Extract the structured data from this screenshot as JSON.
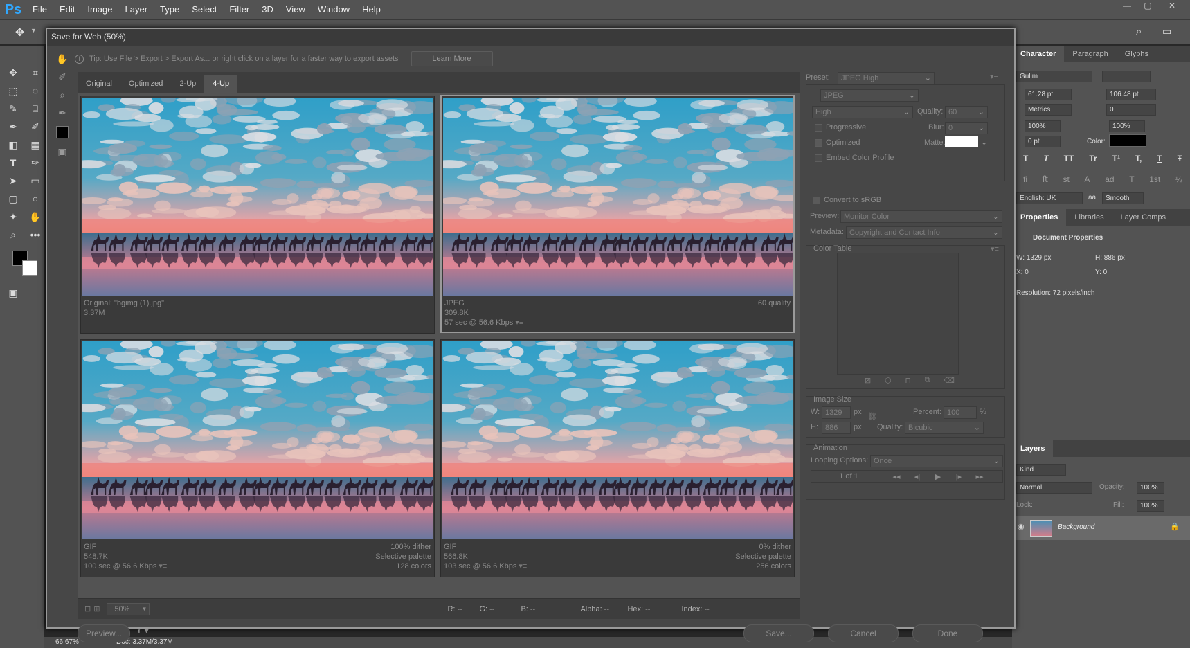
{
  "app": {
    "logo": "Ps"
  },
  "menu": [
    "File",
    "Edit",
    "Image",
    "Layer",
    "Type",
    "Select",
    "Filter",
    "3D",
    "View",
    "Window",
    "Help"
  ],
  "window_controls": [
    "—",
    "▢",
    "✕"
  ],
  "dialog": {
    "title": "Save for Web (50%)",
    "tip": "Tip: Use File > Export > Export As...   or right click on a layer for a faster way to export assets",
    "learn_more": "Learn More",
    "tabs": [
      "Original",
      "Optimized",
      "2-Up",
      "4-Up"
    ],
    "active_tab": "4-Up",
    "panes": [
      {
        "left1": "Original: \"bgimg (1).jpg\"",
        "left2": "3.37M",
        "left3": "",
        "right1": "",
        "right2": "",
        "right3": ""
      },
      {
        "left1": "JPEG",
        "left2": "309.8K",
        "left3": "57 sec @ 56.6 Kbps",
        "right1": "60 quality",
        "right2": "",
        "right3": ""
      },
      {
        "left1": "GIF",
        "left2": "548.7K",
        "left3": "100 sec @ 56.6 Kbps",
        "right1": "100% dither",
        "right2": "Selective palette",
        "right3": "128 colors"
      },
      {
        "left1": "GIF",
        "left2": "566.8K",
        "left3": "103 sec @ 56.6 Kbps",
        "right1": "0% dither",
        "right2": "Selective palette",
        "right3": "256 colors"
      }
    ],
    "zoom": "50%",
    "info": {
      "r": "R: --",
      "g": "G: --",
      "b": "B: --",
      "alpha": "Alpha: --",
      "hex": "Hex: --",
      "index": "Index: --"
    },
    "buttons": {
      "preview": "Preview...",
      "save": "Save...",
      "cancel": "Cancel",
      "done": "Done"
    },
    "settings": {
      "preset_label": "Preset:",
      "preset": "JPEG High",
      "format": "JPEG",
      "quality_level": "High",
      "quality_label": "Quality:",
      "quality": "60",
      "progressive": "Progressive",
      "blur_label": "Blur:",
      "blur": "0",
      "optimized": "Optimized",
      "matte_label": "Matte:",
      "embed": "Embed Color Profile",
      "convert": "Convert to sRGB",
      "preview_label": "Preview:",
      "preview": "Monitor Color",
      "metadata_label": "Metadata:",
      "metadata": "Copyright and Contact Info",
      "color_table": "Color Table",
      "image_size": "Image Size",
      "w_label": "W:",
      "w": "1329",
      "h_label": "H:",
      "h": "886",
      "px": "px",
      "percent_label": "Percent:",
      "percent": "100",
      "pct": "%",
      "resample_label": "Quality:",
      "resample": "Bicubic",
      "animation": "Animation",
      "looping_label": "Looping Options:",
      "looping": "Once",
      "frame": "1 of 1"
    }
  },
  "character": {
    "tabs": [
      "Character",
      "Paragraph",
      "Glyphs"
    ],
    "font": "Gulim",
    "size": "61.28 pt",
    "leading": "106.48 pt",
    "kerning": "Metrics",
    "tracking": "0",
    "vscale": "100%",
    "hscale": "100%",
    "baseline": "0 pt",
    "color_label": "Color:",
    "language": "English: UK",
    "aa_label": "aa",
    "antialias": "Smooth",
    "type_styles": [
      "T",
      "T",
      "TT",
      "Tr",
      "T¹",
      "T,",
      "T",
      "Ŧ"
    ],
    "opentype": [
      "fi",
      "ﬅ",
      "st",
      "A",
      "ad",
      "T",
      "1st",
      "½"
    ]
  },
  "properties": {
    "tabs": [
      "Properties",
      "Libraries",
      "Layer Comps"
    ],
    "title": "Document Properties",
    "w": "W:  1329 px",
    "h": "H:  886 px",
    "x": "X:  0",
    "y": "Y:  0",
    "resolution": "Resolution: 72 pixels/inch"
  },
  "layers": {
    "tab": "Layers",
    "kind": "Kind",
    "blend": "Normal",
    "opacity_label": "Opacity:",
    "opacity": "100%",
    "lock_label": "Lock:",
    "fill_label": "Fill:",
    "fill": "100%",
    "layer_name": "Background"
  },
  "status": {
    "zoom": "66.67%",
    "doc": "Doc: 3.37M/3.37M"
  }
}
